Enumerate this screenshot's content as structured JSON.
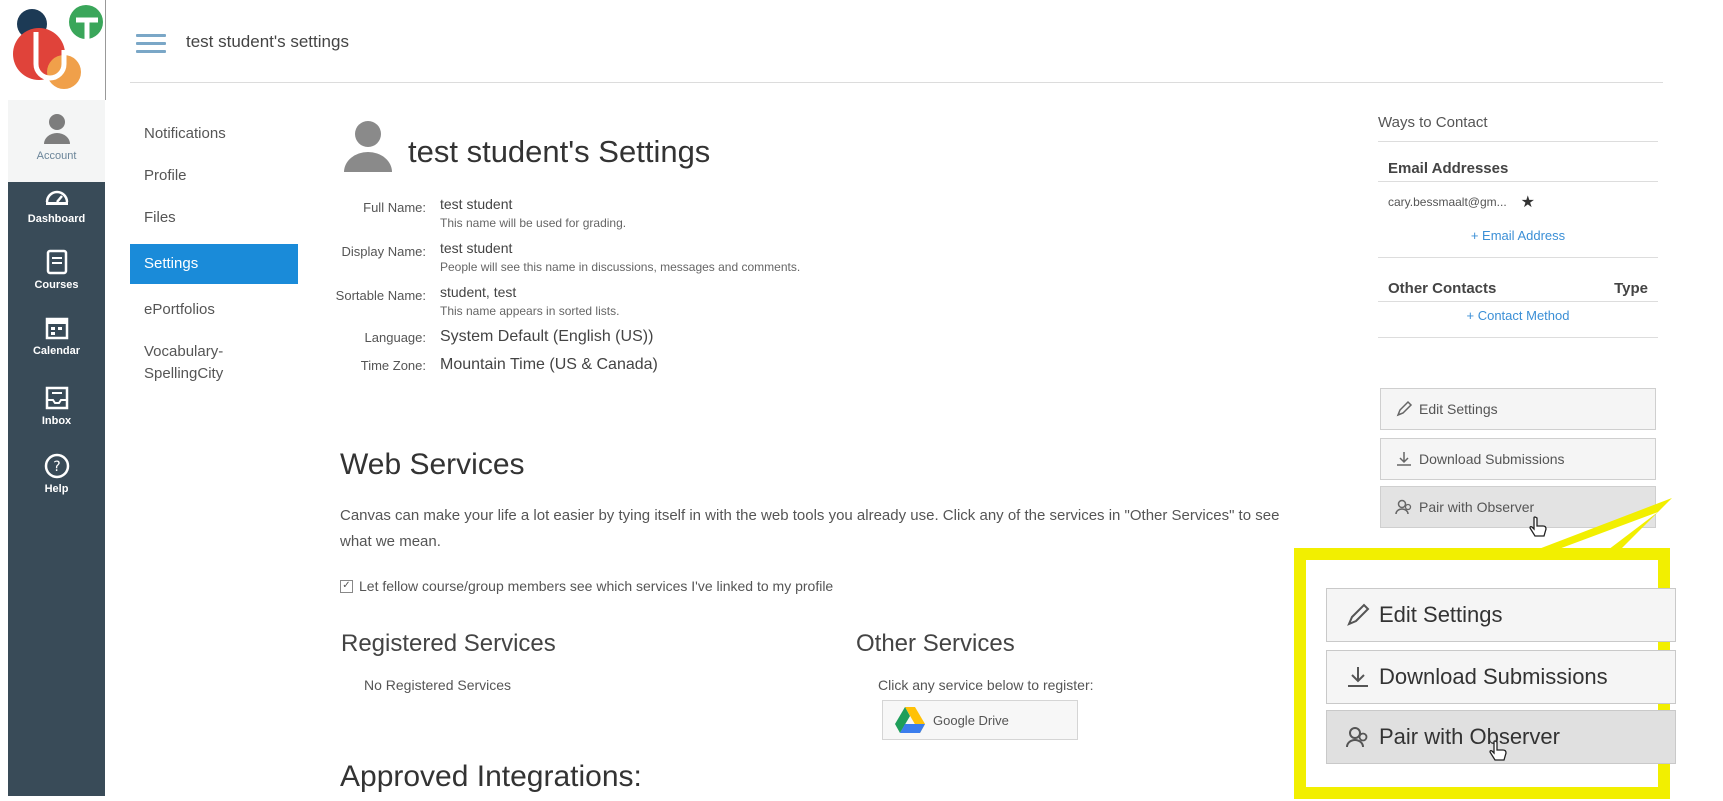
{
  "header": {
    "breadcrumb": "test student's settings"
  },
  "global_nav": {
    "account": "Account",
    "items": [
      {
        "label": "Dashboard",
        "icon": "dashboard-icon"
      },
      {
        "label": "Courses",
        "icon": "courses-icon"
      },
      {
        "label": "Calendar",
        "icon": "calendar-icon"
      },
      {
        "label": "Inbox",
        "icon": "inbox-icon"
      },
      {
        "label": "Help",
        "icon": "help-icon"
      }
    ]
  },
  "sub_nav": {
    "items": [
      {
        "label": "Notifications"
      },
      {
        "label": "Profile"
      },
      {
        "label": "Files"
      },
      {
        "label": "Settings",
        "active": true
      },
      {
        "label": "ePortfolios"
      },
      {
        "label": "Vocabulary-SpellingCity"
      }
    ]
  },
  "main": {
    "title": "test student's Settings",
    "fields": {
      "full_name": {
        "label": "Full Name:",
        "value": "test student",
        "hint": "This name will be used for grading."
      },
      "display_name": {
        "label": "Display Name:",
        "value": "test student",
        "hint": "People will see this name in discussions, messages and comments."
      },
      "sortable_name": {
        "label": "Sortable Name:",
        "value": "student, test",
        "hint": "This name appears in sorted lists."
      },
      "language": {
        "label": "Language:",
        "value": "System Default (English (US))"
      },
      "time_zone": {
        "label": "Time Zone:",
        "value": "Mountain Time (US & Canada)"
      }
    },
    "web_services": {
      "heading": "Web Services",
      "description": "Canvas can make your life a lot easier by tying itself in with the web tools you already use. Click any of the services in \"Other Services\" to see what we mean.",
      "checkbox_label": "Let fellow course/group members see which services I've linked to my profile",
      "checkbox_checked": true,
      "registered_heading": "Registered Services",
      "no_registered": "No Registered Services",
      "other_heading": "Other Services",
      "click_any": "Click any service below to register:",
      "google_drive": "Google Drive"
    },
    "approved_heading": "Approved Integrations:"
  },
  "sidebar": {
    "ways_to_contact": "Ways to Contact",
    "email_addresses": "Email Addresses",
    "email": "cary.bessmaalt@gm...",
    "add_email": "+ Email Address",
    "other_contacts": "Other Contacts",
    "type": "Type",
    "add_contact": "+ Contact Method",
    "edit_settings": "Edit Settings",
    "download_submissions": "Download Submissions",
    "pair_with_observer": "Pair with Observer"
  },
  "callout": {
    "edit_settings": "Edit Settings",
    "download_submissions": "Download Submissions",
    "pair_with_observer": "Pair with Observer"
  },
  "colors": {
    "nav_bg": "#394b58",
    "active_blue": "#1a8bd9",
    "callout_yellow": "#f2ef00",
    "link_blue": "#3b8fd6"
  }
}
